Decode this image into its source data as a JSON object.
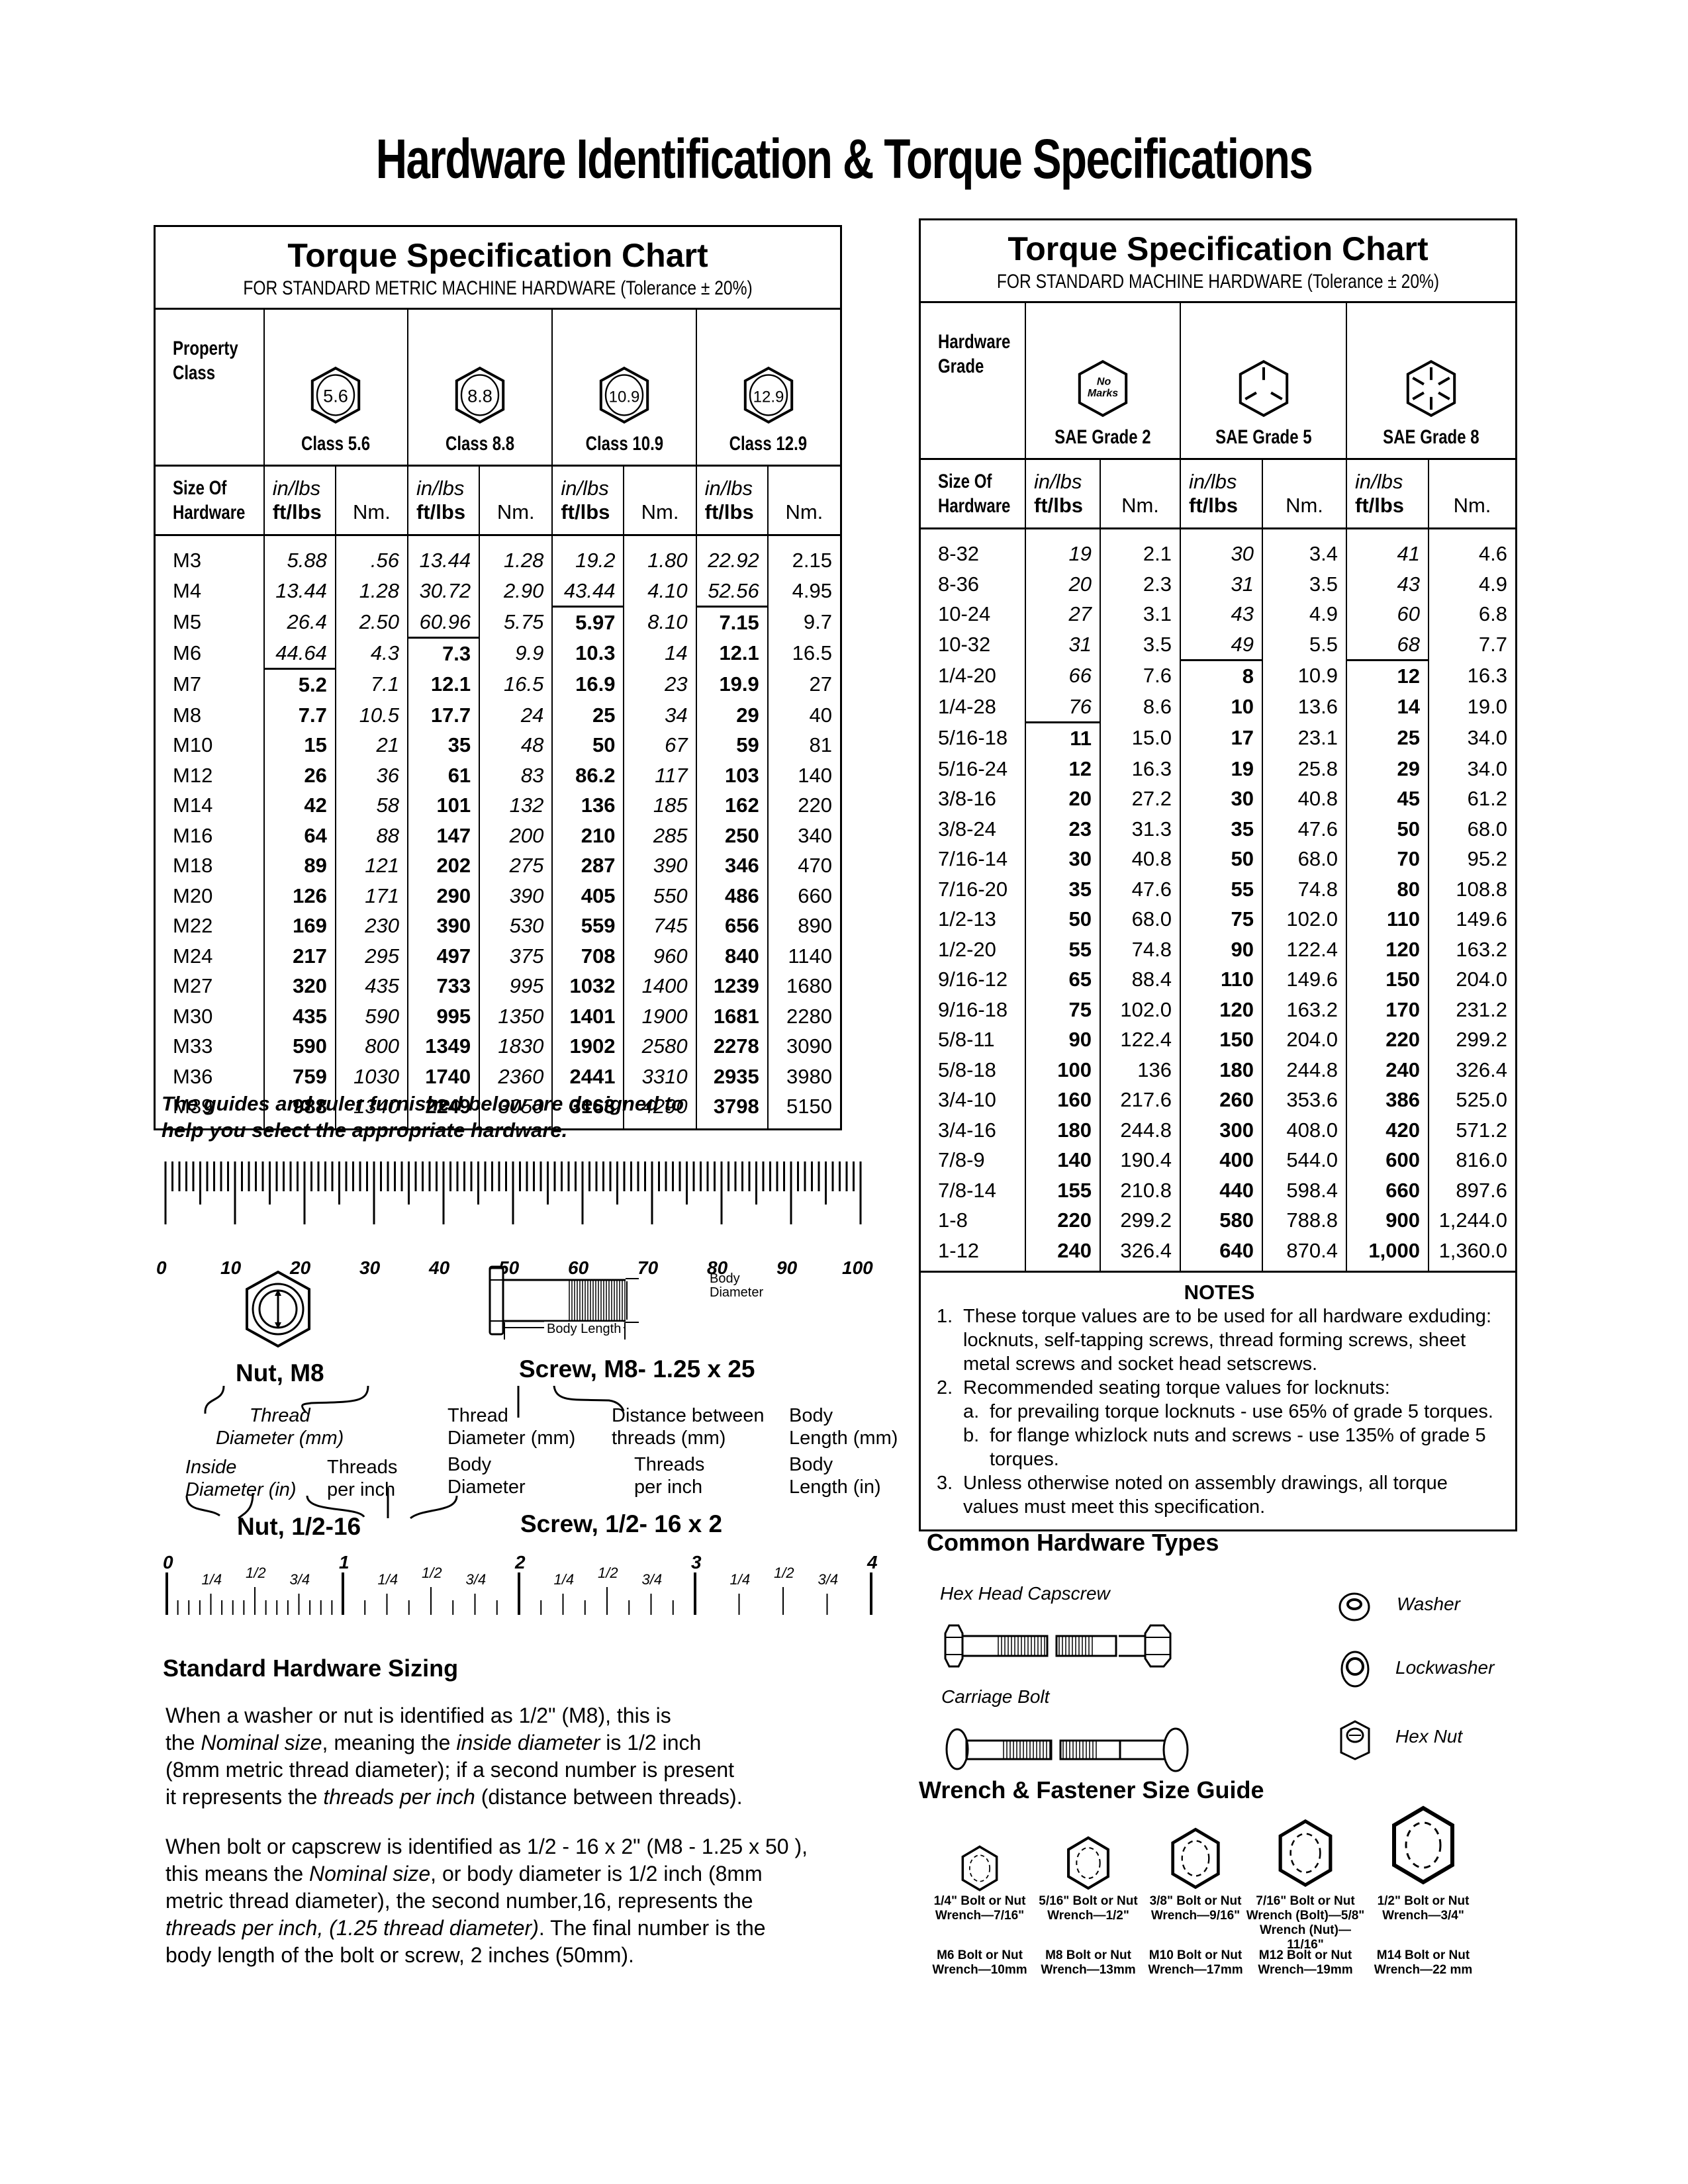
{
  "page_title": "Hardware Identification  &  Torque Specifications",
  "metric_chart": {
    "title": "Torque Specification Chart",
    "subtitle": "FOR STANDARD METRIC MACHINE HARDWARE (Tolerance ± 20%)",
    "property_label": [
      "Property",
      "Class"
    ],
    "classes": [
      {
        "mark": "5.6",
        "label": "Class 5.6"
      },
      {
        "mark": "8.8",
        "label": "Class 8.8"
      },
      {
        "mark": "10.9",
        "label": "Class 10.9"
      },
      {
        "mark": "12.9",
        "label": "Class 12.9"
      }
    ],
    "size_label": [
      "Size Of",
      "Hardware"
    ],
    "unit_top": "in/lbs",
    "unit_bottom": "ft/lbs",
    "unit_nm": "Nm.",
    "rows": [
      [
        "M3",
        "5.88",
        ".56",
        "13.44",
        "1.28",
        "19.2",
        "1.80",
        "22.92",
        "2.15"
      ],
      [
        "M4",
        "13.44",
        "1.28",
        "30.72",
        "2.90",
        "43.44",
        "4.10",
        "52.56",
        "4.95"
      ],
      [
        "M5",
        "26.4",
        "2.50",
        "60.96",
        "5.75",
        "5.97",
        "8.10",
        "7.15",
        "9.7"
      ],
      [
        "M6",
        "44.64",
        "4.3",
        "7.3",
        "9.9",
        "10.3",
        "14",
        "12.1",
        "16.5"
      ],
      [
        "M7",
        "5.2",
        "7.1",
        "12.1",
        "16.5",
        "16.9",
        "23",
        "19.9",
        "27"
      ],
      [
        "M8",
        "7.7",
        "10.5",
        "17.7",
        "24",
        "25",
        "34",
        "29",
        "40"
      ],
      [
        "M10",
        "15",
        "21",
        "35",
        "48",
        "50",
        "67",
        "59",
        "81"
      ],
      [
        "M12",
        "26",
        "36",
        "61",
        "83",
        "86.2",
        "117",
        "103",
        "140"
      ],
      [
        "M14",
        "42",
        "58",
        "101",
        "132",
        "136",
        "185",
        "162",
        "220"
      ],
      [
        "M16",
        "64",
        "88",
        "147",
        "200",
        "210",
        "285",
        "250",
        "340"
      ],
      [
        "M18",
        "89",
        "121",
        "202",
        "275",
        "287",
        "390",
        "346",
        "470"
      ],
      [
        "M20",
        "126",
        "171",
        "290",
        "390",
        "405",
        "550",
        "486",
        "660"
      ],
      [
        "M22",
        "169",
        "230",
        "390",
        "530",
        "559",
        "745",
        "656",
        "890"
      ],
      [
        "M24",
        "217",
        "295",
        "497",
        "375",
        "708",
        "960",
        "840",
        "1140"
      ],
      [
        "M27",
        "320",
        "435",
        "733",
        "995",
        "1032",
        "1400",
        "1239",
        "1680"
      ],
      [
        "M30",
        "435",
        "590",
        "995",
        "1350",
        "1401",
        "1900",
        "1681",
        "2280"
      ],
      [
        "M33",
        "590",
        "800",
        "1349",
        "1830",
        "1902",
        "2580",
        "2278",
        "3090"
      ],
      [
        "M36",
        "759",
        "1030",
        "1740",
        "2360",
        "2441",
        "3310",
        "2935",
        "3980"
      ],
      [
        "M39",
        "988",
        "1340",
        "2249",
        "3050",
        "3163",
        "4290",
        "3798",
        "5150"
      ]
    ],
    "inlbs_rows_per_class": [
      4,
      3,
      2,
      2
    ]
  },
  "sae_chart": {
    "title": "Torque Specification Chart",
    "subtitle": "FOR STANDARD MACHINE HARDWARE (Tolerance ± 20%)",
    "grade_label": [
      "Hardware",
      "Grade"
    ],
    "grades": [
      {
        "mark": "No Marks",
        "label": "SAE Grade 2"
      },
      {
        "mark": "3 radial lines",
        "label": "SAE Grade 5"
      },
      {
        "mark": "6 radial lines",
        "label": "SAE Grade 8"
      }
    ],
    "size_label": [
      "Size Of",
      "Hardware"
    ],
    "unit_top": "in/lbs",
    "unit_bottom": "ft/lbs",
    "unit_nm": "Nm.",
    "rows": [
      [
        "8-32",
        "19",
        "2.1",
        "30",
        "3.4",
        "41",
        "4.6"
      ],
      [
        "8-36",
        "20",
        "2.3",
        "31",
        "3.5",
        "43",
        "4.9"
      ],
      [
        "10-24",
        "27",
        "3.1",
        "43",
        "4.9",
        "60",
        "6.8"
      ],
      [
        "10-32",
        "31",
        "3.5",
        "49",
        "5.5",
        "68",
        "7.7"
      ],
      [
        "1/4-20",
        "66",
        "7.6",
        "8",
        "10.9",
        "12",
        "16.3"
      ],
      [
        "1/4-28",
        "76",
        "8.6",
        "10",
        "13.6",
        "14",
        "19.0"
      ],
      [
        "5/16-18",
        "11",
        "15.0",
        "17",
        "23.1",
        "25",
        "34.0"
      ],
      [
        "5/16-24",
        "12",
        "16.3",
        "19",
        "25.8",
        "29",
        "34.0"
      ],
      [
        "3/8-16",
        "20",
        "27.2",
        "30",
        "40.8",
        "45",
        "61.2"
      ],
      [
        "3/8-24",
        "23",
        "31.3",
        "35",
        "47.6",
        "50",
        "68.0"
      ],
      [
        "7/16-14",
        "30",
        "40.8",
        "50",
        "68.0",
        "70",
        "95.2"
      ],
      [
        "7/16-20",
        "35",
        "47.6",
        "55",
        "74.8",
        "80",
        "108.8"
      ],
      [
        "1/2-13",
        "50",
        "68.0",
        "75",
        "102.0",
        "110",
        "149.6"
      ],
      [
        "1/2-20",
        "55",
        "74.8",
        "90",
        "122.4",
        "120",
        "163.2"
      ],
      [
        "9/16-12",
        "65",
        "88.4",
        "110",
        "149.6",
        "150",
        "204.0"
      ],
      [
        "9/16-18",
        "75",
        "102.0",
        "120",
        "163.2",
        "170",
        "231.2"
      ],
      [
        "5/8-11",
        "90",
        "122.4",
        "150",
        "204.0",
        "220",
        "299.2"
      ],
      [
        "5/8-18",
        "100",
        "136",
        "180",
        "244.8",
        "240",
        "326.4"
      ],
      [
        "3/4-10",
        "160",
        "217.6",
        "260",
        "353.6",
        "386",
        "525.0"
      ],
      [
        "3/4-16",
        "180",
        "244.8",
        "300",
        "408.0",
        "420",
        "571.2"
      ],
      [
        "7/8-9",
        "140",
        "190.4",
        "400",
        "544.0",
        "600",
        "816.0"
      ],
      [
        "7/8-14",
        "155",
        "210.8",
        "440",
        "598.4",
        "660",
        "897.6"
      ],
      [
        "1-8",
        "220",
        "299.2",
        "580",
        "788.8",
        "900",
        "1,244.0"
      ],
      [
        "1-12",
        "240",
        "326.4",
        "640",
        "870.4",
        "1,000",
        "1,360.0"
      ]
    ],
    "inlbs_rows_per_grade": [
      6,
      4,
      4
    ],
    "notes_heading": "NOTES",
    "notes": [
      {
        "num": "1.",
        "text": "These torque values are to be used for all hardware exduding: locknuts, self-tapping screws, thread forming screws, sheet metal screws and socket head setscrews."
      },
      {
        "num": "2.",
        "text": "Recommended seating torque values for locknuts:",
        "subs": [
          {
            "num": "a.",
            "text": "for prevailing torque locknuts - use 65% of grade 5 torques."
          },
          {
            "num": "b.",
            "text": "for flange whizlock nuts and screws - use 135% of grade 5 torques."
          }
        ]
      },
      {
        "num": "3.",
        "text": "Unless otherwise noted on assembly drawings, all torque values must meet this specification."
      }
    ]
  },
  "guide_intro": [
    "The guides and ruler furnished below are designed to",
    "help you select the appropriate hardware."
  ],
  "mm_ruler": {
    "labels": [
      "0",
      "10",
      "20",
      "30",
      "40",
      "50",
      "60",
      "70",
      "80",
      "90",
      "100"
    ]
  },
  "diagrams": {
    "body_diameter": [
      "Body",
      "Diameter"
    ],
    "body_length": "Body Length",
    "nut_metric": "Nut, M8",
    "screw_metric": "Screw, M8- 1.25 x 25",
    "nut_metric_note": [
      "Thread",
      "Diameter (mm)"
    ],
    "screw_metric_notes": [
      [
        "Thread",
        "Diameter (mm)"
      ],
      [
        "Distance between",
        "threads (mm)"
      ],
      [
        "Body",
        "Length (mm)"
      ]
    ],
    "nut_inch_notes": [
      [
        "Inside",
        "Diameter (in)"
      ],
      [
        "Threads",
        "per inch"
      ]
    ],
    "screw_inch_notes": [
      [
        "Body",
        "Diameter"
      ],
      [
        "Threads",
        "per inch"
      ],
      [
        "Body",
        "Length (in)"
      ]
    ],
    "nut_inch": "Nut, 1/2-16",
    "screw_inch": "Screw, 1/2- 16 x 2"
  },
  "inch_ruler": {
    "majors": [
      "0",
      "1",
      "2",
      "3",
      "4"
    ],
    "fractions": [
      "1/4",
      "1/2",
      "3/4"
    ]
  },
  "sizing": {
    "heading": "Standard Hardware Sizing",
    "para1": [
      {
        "t": "When a washer or nut is identified as 1/2\" (M8), this is"
      },
      {
        "t": "the ",
        "i": "Nominal size",
        "t2": ", meaning the ",
        "i2": "inside diameter",
        "t3": " is 1/2 inch"
      },
      {
        "t": "(8mm metric thread diameter); if a second number is present"
      },
      {
        "t": "it represents the ",
        "i": "threads per inch",
        "t2": " (distance between threads)."
      }
    ],
    "para2": [
      {
        "t": "When bolt or capscrew is identified as 1/2 - 16 x 2\" (M8 - 1.25 x 50 ),"
      },
      {
        "t": "this means the ",
        "i": "Nominal size",
        "t2": ", or body diameter is 1/2 inch (8mm"
      },
      {
        "t": "metric thread diameter), the second number,16, represents the"
      },
      {
        "i": "threads per inch, (1.25 thread diameter)",
        "t2": ". The final number is the"
      },
      {
        "t": "body length of the bolt or screw, 2 inches (50mm)."
      }
    ]
  },
  "common_types": {
    "heading": "Common Hardware Types",
    "bolts": [
      "Hex Head Capscrew",
      "Carriage Bolt"
    ],
    "small": [
      "Washer",
      "Lockwasher",
      "Hex Nut"
    ]
  },
  "wrench_guide": {
    "heading": "Wrench & Fastener Size Guide",
    "items": [
      {
        "inch": [
          "1/4\" Bolt or Nut",
          "Wrench—7/16\""
        ],
        "metric": [
          "M6 Bolt or Nut",
          "Wrench—10mm"
        ]
      },
      {
        "inch": [
          "5/16\" Bolt or Nut",
          "Wrench—1/2\""
        ],
        "metric": [
          "M8 Bolt or Nut",
          "Wrench—13mm"
        ]
      },
      {
        "inch": [
          "3/8\" Bolt or Nut",
          "Wrench—9/16\""
        ],
        "metric": [
          "M10 Bolt or Nut",
          "Wrench—17mm"
        ]
      },
      {
        "inch": [
          "7/16\" Bolt or Nut",
          "Wrench (Bolt)—5/8\"",
          "Wrench (Nut)—11/16\""
        ],
        "metric": [
          "M12 Bolt or Nut",
          "Wrench—19mm"
        ]
      },
      {
        "inch": [
          "1/2\" Bolt or Nut",
          "Wrench—3/4\""
        ],
        "metric": [
          "M14 Bolt or Nut",
          "Wrench—22 mm"
        ]
      }
    ]
  }
}
